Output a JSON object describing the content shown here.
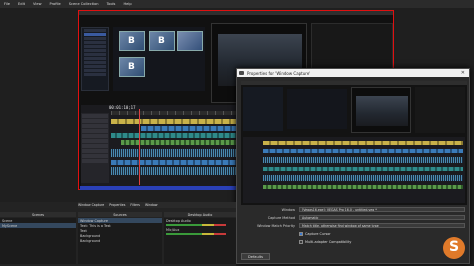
{
  "menu": [
    "File",
    "Edit",
    "View",
    "Profile",
    "Scene Collection",
    "Tools",
    "Help"
  ],
  "editor": {
    "timecode": "00:01:10;17",
    "thumb_glyphs": [
      "B",
      "B",
      "B"
    ]
  },
  "dialog": {
    "title": "Properties for 'Window Capture'",
    "fields": [
      {
        "label": "Window",
        "value": "[Vegas16.exe]: VEGAS Pro 16.0 - untitled.veg * "
      },
      {
        "label": "Capture Method",
        "value": "Automatic"
      },
      {
        "label": "Window Match Priority",
        "value": "Match title, otherwise find window of same type"
      }
    ],
    "checks": [
      {
        "label": "Capture Cursor",
        "checked": true
      },
      {
        "label": "Multi-adapter Compatibility",
        "checked": false
      }
    ],
    "defaults_button": "Defaults"
  },
  "docks": {
    "scenes_header": "Scenes",
    "scenes": [
      "Scene",
      "MyScene"
    ],
    "sources_header": "Sources",
    "sources": [
      "Window Capture",
      "Text: This is a Test",
      "Text",
      "Background",
      "Background"
    ],
    "toolbar": [
      "Window Capture",
      "Properties",
      "Filters",
      "Window"
    ],
    "mixer_header": "Desktop Audio",
    "mixer_labels": [
      "Desktop Audio",
      "Mic/Aux"
    ]
  },
  "colors": {
    "recording_border": "#e01010",
    "accent_blue": "#2a40b8",
    "logo": "#e07a2a"
  }
}
